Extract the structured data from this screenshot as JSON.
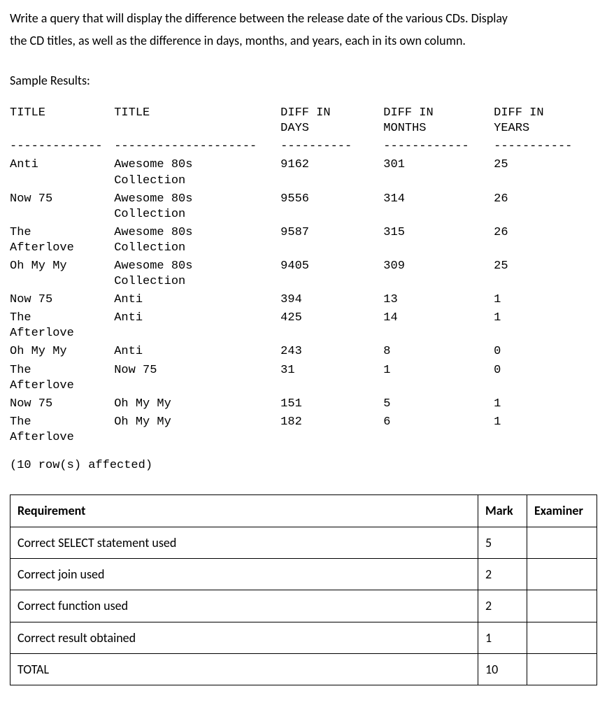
{
  "question": {
    "line1": "Write a query that will display the difference between the release date of the various CDs. Display",
    "line2": "the CD titles, as well as the difference in days, months, and years, each in its own column."
  },
  "sample_results_label": "Sample Results:",
  "headers": {
    "title1": "TITLE",
    "title2": "TITLE",
    "diff_days_l1": "DIFF IN",
    "diff_days_l2": "DAYS",
    "diff_months_l1": "DIFF IN",
    "diff_months_l2": "MONTHS",
    "diff_years_l1": "DIFF IN",
    "diff_years_l2": "YEARS"
  },
  "dashes": {
    "c1": "-------------",
    "c2": "--------------------",
    "c3": "----------",
    "c4": "------------",
    "c5": "-----------"
  },
  "rows": [
    {
      "t1_l1": "Anti",
      "t1_l2": "",
      "t2_l1": "Awesome 80s",
      "t2_l2": "Collection",
      "days": "9162",
      "months": "301",
      "years": "25"
    },
    {
      "t1_l1": "Now 75",
      "t1_l2": "",
      "t2_l1": "Awesome 80s",
      "t2_l2": "Collection",
      "days": "9556",
      "months": "314",
      "years": "26"
    },
    {
      "t1_l1": "The",
      "t1_l2": "Afterlove",
      "t2_l1": "Awesome 80s",
      "t2_l2": "Collection",
      "days": "9587",
      "months": "315",
      "years": "26"
    },
    {
      "t1_l1": "Oh My My",
      "t1_l2": "",
      "t2_l1": "Awesome 80s",
      "t2_l2": "Collection",
      "days": "9405",
      "months": "309",
      "years": "25"
    },
    {
      "t1_l1": "Now 75",
      "t1_l2": "",
      "t2_l1": "Anti",
      "t2_l2": "",
      "days": "394",
      "months": "13",
      "years": "1"
    },
    {
      "t1_l1": "The",
      "t1_l2": "Afterlove",
      "t2_l1": "Anti",
      "t2_l2": "",
      "days": "425",
      "months": "14",
      "years": "1"
    },
    {
      "t1_l1": "Oh My My",
      "t1_l2": "",
      "t2_l1": "Anti",
      "t2_l2": "",
      "days": "243",
      "months": "8",
      "years": "0"
    },
    {
      "t1_l1": "The",
      "t1_l2": "Afterlove",
      "t2_l1": "Now 75",
      "t2_l2": "",
      "days": "31",
      "months": "1",
      "years": "0"
    },
    {
      "t1_l1": "Now 75",
      "t1_l2": "",
      "t2_l1": "Oh My My",
      "t2_l2": "",
      "days": "151",
      "months": "5",
      "years": "1"
    },
    {
      "t1_l1": "The",
      "t1_l2": "Afterlove",
      "t2_l1": "Oh My My",
      "t2_l2": "",
      "days": "182",
      "months": "6",
      "years": "1"
    }
  ],
  "rows_affected": "(10 row(s) affected)",
  "rubric": {
    "header_req": "Requirement",
    "header_mark": "Mark",
    "header_exam": "Examiner",
    "items": [
      {
        "req": "Correct SELECT statement used",
        "mark": "5"
      },
      {
        "req": "Correct join used",
        "mark": "2"
      },
      {
        "req": "Correct function used",
        "mark": "2"
      },
      {
        "req": "Correct result obtained",
        "mark": "1"
      }
    ],
    "total_label": "TOTAL",
    "total_mark": "10"
  }
}
